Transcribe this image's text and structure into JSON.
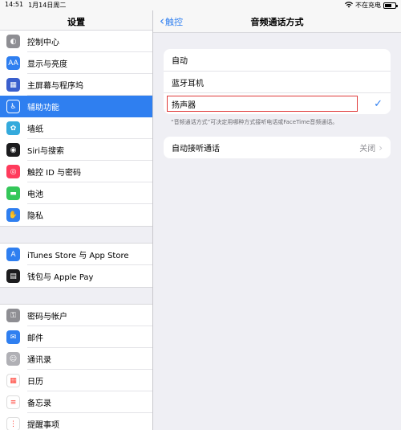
{
  "status": {
    "time": "14:51",
    "date": "1月14日周二",
    "charging": "不在充电"
  },
  "sidebar": {
    "title": "设置",
    "groups": [
      [
        {
          "label": "控制中心",
          "icon": "toggle-icon",
          "color": "#8e8e93"
        },
        {
          "label": "显示与亮度",
          "icon": "aa-icon",
          "color": "#2f7ff0"
        },
        {
          "label": "主屏幕与程序坞",
          "icon": "grid-icon",
          "color": "#3a5fcd"
        },
        {
          "label": "辅助功能",
          "icon": "accessibility-icon",
          "color": "#2f7ff0",
          "selected": true
        },
        {
          "label": "墙纸",
          "icon": "flower-icon",
          "color": "#34aadc"
        },
        {
          "label": "Siri与搜索",
          "icon": "siri-icon",
          "color": "#1c1c1e"
        },
        {
          "label": "触控 ID 与密码",
          "icon": "fingerprint-icon",
          "color": "#ff3b5c"
        },
        {
          "label": "电池",
          "icon": "battery-icon",
          "color": "#34c759"
        },
        {
          "label": "隐私",
          "icon": "hand-icon",
          "color": "#2f7ff0"
        }
      ],
      [
        {
          "label": "iTunes Store 与 App Store",
          "icon": "appstore-icon",
          "color": "#2f7ff0"
        },
        {
          "label": "钱包与 Apple Pay",
          "icon": "wallet-icon",
          "color": "#1c1c1e"
        }
      ],
      [
        {
          "label": "密码与帐户",
          "icon": "key-icon",
          "color": "#8e8e93"
        },
        {
          "label": "邮件",
          "icon": "mail-icon",
          "color": "#2f7ff0"
        },
        {
          "label": "通讯录",
          "icon": "contacts-icon",
          "color": "#b0b0b5"
        },
        {
          "label": "日历",
          "icon": "calendar-icon",
          "color": "#ffffff"
        },
        {
          "label": "备忘录",
          "icon": "notes-icon",
          "color": "#ffffff"
        },
        {
          "label": "提醒事项",
          "icon": "reminders-icon",
          "color": "#ffffff"
        }
      ]
    ]
  },
  "nav": {
    "back": "触控",
    "title": "音频通话方式"
  },
  "options": [
    {
      "label": "自动",
      "checked": false
    },
    {
      "label": "蓝牙耳机",
      "checked": false
    },
    {
      "label": "扬声器",
      "checked": true
    }
  ],
  "options_note": "“音频通话方式”可决定用哪种方式接听电话或FaceTime音频通话。",
  "auto_answer": {
    "label": "自动接听通话",
    "value": "关闭"
  },
  "colors": {
    "accent": "#2f7ff0",
    "highlight": "#e03b3b"
  }
}
